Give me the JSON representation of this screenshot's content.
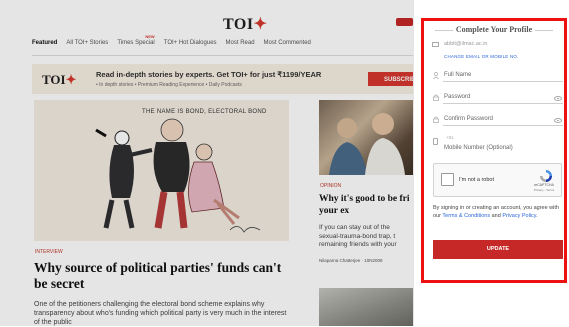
{
  "site": {
    "logo_text": "TOI",
    "logo_plus": "✦",
    "nav": [
      {
        "label": "Featured",
        "active": true
      },
      {
        "label": "All TOI+ Stories"
      },
      {
        "label": "Times Special",
        "tag": "NEW"
      },
      {
        "label": "TOI+ Hot Dialogues"
      },
      {
        "label": "Most Read"
      },
      {
        "label": "Most Commented"
      }
    ]
  },
  "banner": {
    "logo_text": "TOI",
    "logo_plus": "✦",
    "title": "Read in-depth stories by experts. Get TOI+ for just ₹1199/YEAR",
    "features": "• In depth stories   • Premium Reading Experience   • Daily Podcasts",
    "button": "SUBSCRIBE"
  },
  "lead_article": {
    "cartoon_caption": "THE NAME IS BOND, ELECTORAL BOND",
    "kicker": "INTERVIEW",
    "headline": "Why source of political parties' funds can't be secret",
    "summary": "One of the petitioners challenging the electoral bond scheme explains why transparency about who's funding which political party is very much in the interest of the public"
  },
  "side_article": {
    "kicker": "OPINION",
    "headline_line1": "Why it's good to be fri",
    "headline_line2": "your ex",
    "summary_line1": "If you can stay out of the",
    "summary_line2": "sexual-trauma-bond trap, t",
    "summary_line3": "remaining friends with your",
    "author": "Nilaparna Chatterjee · 10N2008"
  },
  "profile_panel": {
    "title": "Complete Your Profile",
    "email": "abbit@ilmac.ac.in",
    "change_link": "CHANGE EMAIL OR MOBILE NO.",
    "full_name_placeholder": "Full Name",
    "password_placeholder": "Password",
    "confirm_placeholder": "Confirm Password",
    "mobile_prefix": "+91",
    "mobile_placeholder": "Mobile Number (Optional)",
    "captcha_label": "I'm not a robot",
    "captcha_brand": "reCAPTCHA",
    "captcha_terms": "Privacy - Terms",
    "consent_prefix": "By signing in or creating an account, you agree with our ",
    "consent_link1": "Terms & Conditions",
    "consent_middle": " and ",
    "consent_link2": "Privacy Policy",
    "consent_suffix": ".",
    "update_button": "UPDATE"
  },
  "colors": {
    "accent_red": "#c62828",
    "highlight_border": "#ee1111",
    "link_blue": "#2b66d9"
  }
}
